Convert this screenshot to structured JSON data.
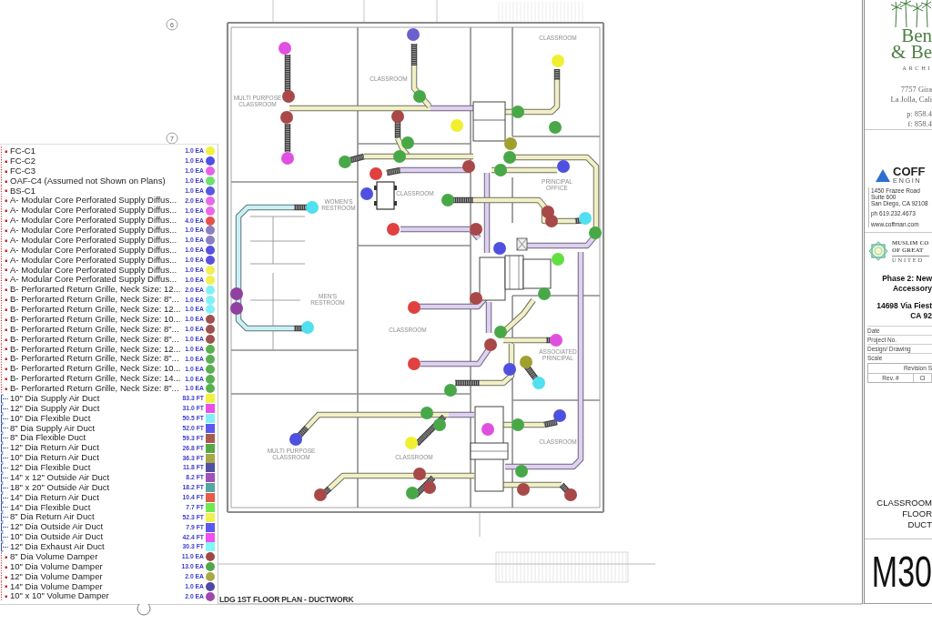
{
  "sheet": {
    "grid_bubbles": [
      "6",
      "7"
    ]
  },
  "floor_plan": {
    "title": "LDG 1ST FLOOR PLAN - DUCTWORK",
    "rooms": [
      {
        "lines": [
          "CLASSROOM"
        ]
      },
      {
        "lines": [
          "CLASSROOM"
        ]
      },
      {
        "lines": [
          "MULTI PURPOSE",
          "CLASSROOM"
        ]
      },
      {
        "lines": [
          "PRINCIPAL",
          "OFFICE"
        ]
      },
      {
        "lines": [
          "CLASSROOM"
        ]
      },
      {
        "lines": [
          "WOMEN'S",
          "RESTROOM"
        ]
      },
      {
        "lines": [
          "MEN'S",
          "RESTROOM"
        ]
      },
      {
        "lines": [
          "CLASSROOM"
        ]
      },
      {
        "lines": [
          "ASSOCIATED",
          "PRINCIPAL"
        ]
      },
      {
        "lines": [
          "CLASSROOM"
        ]
      },
      {
        "lines": [
          "MULTI PURPOSE",
          "CLASSROOM"
        ]
      },
      {
        "lines": [
          "CLASSROOM"
        ]
      }
    ],
    "markers": [
      {
        "color": "#e050e0"
      },
      {
        "color": "#e050e0"
      },
      {
        "color": "#a84848"
      },
      {
        "color": "#a84848"
      },
      {
        "color": "#6a60d0"
      },
      {
        "color": "#f0f030"
      },
      {
        "color": "#48a848"
      },
      {
        "color": "#a84848"
      },
      {
        "color": "#f0f030"
      },
      {
        "color": "#48a848"
      },
      {
        "color": "#a0a030"
      },
      {
        "color": "#48a848"
      },
      {
        "color": "#48a848"
      },
      {
        "color": "#48a848"
      },
      {
        "color": "#48a848"
      },
      {
        "color": "#48a848"
      },
      {
        "color": "#48a848"
      },
      {
        "color": "#a84848"
      },
      {
        "color": "#5050e0"
      },
      {
        "color": "#e04040"
      },
      {
        "color": "#5050e0"
      },
      {
        "color": "#48a848"
      },
      {
        "color": "#50e0f0"
      },
      {
        "color": "#a84848"
      },
      {
        "color": "#a84848"
      },
      {
        "color": "#50e0f0"
      },
      {
        "color": "#48a848"
      },
      {
        "color": "#e04040"
      },
      {
        "color": "#a84848"
      },
      {
        "color": "#5050e0"
      },
      {
        "color": "#60e040"
      },
      {
        "color": "#9040a0"
      },
      {
        "color": "#9040a0"
      },
      {
        "color": "#a84848"
      },
      {
        "color": "#48a848"
      },
      {
        "color": "#50e0f0"
      },
      {
        "color": "#e04040"
      },
      {
        "color": "#48a848"
      },
      {
        "color": "#a84848"
      },
      {
        "color": "#e050e0"
      },
      {
        "color": "#e04040"
      },
      {
        "color": "#5050e0"
      },
      {
        "color": "#a0a030"
      },
      {
        "color": "#50e0f0"
      },
      {
        "color": "#48a848"
      },
      {
        "color": "#48a848"
      },
      {
        "color": "#48a848"
      },
      {
        "color": "#e050e0"
      },
      {
        "color": "#48a848"
      },
      {
        "color": "#5050e0"
      },
      {
        "color": "#5050e0"
      },
      {
        "color": "#f0f030"
      },
      {
        "color": "#48a848"
      },
      {
        "color": "#a84848"
      },
      {
        "color": "#a84848"
      },
      {
        "color": "#48a848"
      },
      {
        "color": "#a84848"
      },
      {
        "color": "#a84848"
      },
      {
        "color": "#a84848"
      }
    ]
  },
  "legend": {
    "items": [
      {
        "kind": "count",
        "label": "FC-C1",
        "quantity": "1.0 EA",
        "color": "#f0f040"
      },
      {
        "kind": "count",
        "label": "FC-C2",
        "quantity": "1.0 EA",
        "color": "#5050e8"
      },
      {
        "kind": "count",
        "label": "FC-C3",
        "quantity": "1.0 EA",
        "color": "#e860e8"
      },
      {
        "kind": "count",
        "label": "OAF-C4 (Assumed not Shown on Plans)",
        "quantity": "1.0 EA",
        "color": "#70e070"
      },
      {
        "kind": "count",
        "label": "BS-C1",
        "quantity": "1.0 EA",
        "color": "#5858e0"
      },
      {
        "kind": "count",
        "label": "A- Modular Core Perforated Supply Diffus...",
        "quantity": "2.0 EA",
        "color": "#e868e8"
      },
      {
        "kind": "count",
        "label": "A- Modular Core Perforated Supply Diffus...",
        "quantity": "1.0 EA",
        "color": "#e868e8"
      },
      {
        "kind": "count",
        "label": "A- Modular Core Perforated Supply Diffus...",
        "quantity": "4.0 EA",
        "color": "#e85050"
      },
      {
        "kind": "count",
        "label": "A- Modular Core Perforated Supply Diffus...",
        "quantity": "1.0 EA",
        "color": "#8a80c0"
      },
      {
        "kind": "count",
        "label": "A- Modular Core Perforated Supply Diffus...",
        "quantity": "1.0 EA",
        "color": "#8a80c0"
      },
      {
        "kind": "count",
        "label": "A- Modular Core Perforated Supply Diffus...",
        "quantity": "1.0 EA",
        "color": "#5a50e0"
      },
      {
        "kind": "count",
        "label": "A- Modular Core Perforated Supply Diffus...",
        "quantity": "1.0 EA",
        "color": "#5a50e0"
      },
      {
        "kind": "count",
        "label": "A- Modular Core Perforated Supply Diffus...",
        "quantity": "1.0 EA",
        "color": "#f0f050"
      },
      {
        "kind": "count",
        "label": "A- Modular Core Perforated Supply Diffus...",
        "quantity": "1.0 EA",
        "color": "#f0f050"
      },
      {
        "kind": "count",
        "label": "B- Perforarted Return Grille, Neck Size: 12...",
        "quantity": "2.0 EA",
        "color": "#80f0f8"
      },
      {
        "kind": "count",
        "label": "B- Perforarted Return Grille, Neck Size: 8\"...",
        "quantity": "1.0 EA",
        "color": "#80f0f8"
      },
      {
        "kind": "count",
        "label": "B- Perforarted Return Grille, Neck Size: 12...",
        "quantity": "1.0 EA",
        "color": "#80f0f8"
      },
      {
        "kind": "count",
        "label": "B- Perforarted Return Grille, Neck Size: 10...",
        "quantity": "1.0 EA",
        "color": "#a05050"
      },
      {
        "kind": "count",
        "label": "B- Perforarted Return Grille, Neck Size: 8\"...",
        "quantity": "1.0 EA",
        "color": "#a05050"
      },
      {
        "kind": "count",
        "label": "B- Perforarted Return Grille, Neck Size: 8\"...",
        "quantity": "1.0 EA",
        "color": "#a05050"
      },
      {
        "kind": "count",
        "label": "B- Perforarted Return Grille, Neck Size: 12...",
        "quantity": "1.0 EA",
        "color": "#58b050"
      },
      {
        "kind": "count",
        "label": "B- Perforarted Return Grille, Neck Size: 8\"...",
        "quantity": "1.0 EA",
        "color": "#58b050"
      },
      {
        "kind": "count",
        "label": "B- Perforarted Return Grille, Neck Size: 10...",
        "quantity": "1.0 EA",
        "color": "#58b050"
      },
      {
        "kind": "count",
        "label": "B- Perforarted Return Grille, Neck Size: 14...",
        "quantity": "1.0 EA",
        "color": "#58b050"
      },
      {
        "kind": "count",
        "label": "B- Perforarted Return Grille, Neck Size: 8\"...",
        "quantity": "1.0 EA",
        "color": "#58b050"
      },
      {
        "kind": "length",
        "label": "10\" Dia Supply Air Duct",
        "quantity": "83.3 FT",
        "color": "#f0f040"
      },
      {
        "kind": "length",
        "label": "12\" Dia Supply Air Duct",
        "quantity": "31.0 FT",
        "color": "#e850e8"
      },
      {
        "kind": "length",
        "label": "10\" Dia Flexible Duct",
        "quantity": "50.5 FT",
        "color": "#80f0f8"
      },
      {
        "kind": "length",
        "label": "8\" Dia Supply Air Duct",
        "quantity": "52.0 FT",
        "color": "#5a5af0"
      },
      {
        "kind": "length",
        "label": "8\" Dia Flexible Duct",
        "quantity": "59.3 FT",
        "color": "#a85a50"
      },
      {
        "kind": "length",
        "label": "12\" Dia Return Air Duct",
        "quantity": "26.8 FT",
        "color": "#58a848"
      },
      {
        "kind": "length",
        "label": "10\" Dia Return Air Duct",
        "quantity": "36.3 FT",
        "color": "#a8a848"
      },
      {
        "kind": "length",
        "label": "12\" Dia Flexible Duct",
        "quantity": "11.8 FT",
        "color": "#5050a8"
      },
      {
        "kind": "length",
        "label": "14\" x 12\" Outside Air Duct",
        "quantity": "8.2 FT",
        "color": "#a050b8"
      },
      {
        "kind": "length",
        "label": "18\" x 20\" Outside Air Duct",
        "quantity": "18.2 FT",
        "color": "#50a8a0"
      },
      {
        "kind": "length",
        "label": "14\" Dia Return Air Duct",
        "quantity": "10.4 FT",
        "color": "#e85a4a"
      },
      {
        "kind": "length",
        "label": "14\" Dia Flexible Duct",
        "quantity": "7.7 FT",
        "color": "#70e850"
      },
      {
        "kind": "length",
        "label": "8\" Dia Return Air Duct",
        "quantity": "52.3 FT",
        "color": "#f0f050"
      },
      {
        "kind": "length",
        "label": "12\" Dia Outside Air Duct",
        "quantity": "7.9 FT",
        "color": "#5a5af0"
      },
      {
        "kind": "length",
        "label": "10\" Dia Outside Air Duct",
        "quantity": "42.4 FT",
        "color": "#f050f0"
      },
      {
        "kind": "length",
        "label": "12\" Dia Exhaust Air Duct",
        "quantity": "30.3 FT",
        "color": "#80f8f8"
      },
      {
        "kind": "count",
        "label": "8\" Dia Volume Damper",
        "quantity": "11.0 EA",
        "color": "#a04848"
      },
      {
        "kind": "count",
        "label": "10\" Dia Volume Damper",
        "quantity": "13.0 EA",
        "color": "#50a848"
      },
      {
        "kind": "count",
        "label": "12\" Dia Volume Damper",
        "quantity": "2.0 EA",
        "color": "#a8a848"
      },
      {
        "kind": "count",
        "label": "14\" Dia Volume Damper",
        "quantity": "1.0 EA",
        "color": "#5048a8"
      },
      {
        "kind": "count",
        "label": "10\" x 10\" Volume Damper",
        "quantity": "2.0 EA",
        "color": "#a048b0"
      }
    ]
  },
  "title_block": {
    "architect": {
      "name_lines": [
        "Ben",
        "& Be"
      ],
      "tagline": "ARCHI",
      "address": [
        "7757 Gira",
        "La Jolla, Cali"
      ],
      "phone": [
        "p: 858.4",
        "f: 858.4"
      ]
    },
    "engineer": {
      "name": "COFF",
      "subtitle": "ENGIN",
      "address": [
        "1450 Frazee Road",
        "Suite 600",
        "San Diego, CA 92108",
        "ph 619.232.4673",
        "www.coffman.com"
      ]
    },
    "client": {
      "lines": [
        "MUSLIM CO",
        "OF GREAT"
      ],
      "tagline": "UNITED"
    },
    "project": {
      "title": [
        "Phase 2: New",
        "Accessory"
      ],
      "address": [
        "14698 Via Fiest",
        "CA 92"
      ]
    },
    "info_rows": [
      "Date",
      "Project No.",
      "Design/ Drawing",
      "Scale"
    ],
    "revision": {
      "title": "Revision S",
      "columns": [
        "Rev. #",
        "Cl"
      ]
    },
    "sheet_title": [
      "CLASSROOM",
      "FLOOR",
      "DUCT"
    ],
    "sheet_number": "M30"
  }
}
